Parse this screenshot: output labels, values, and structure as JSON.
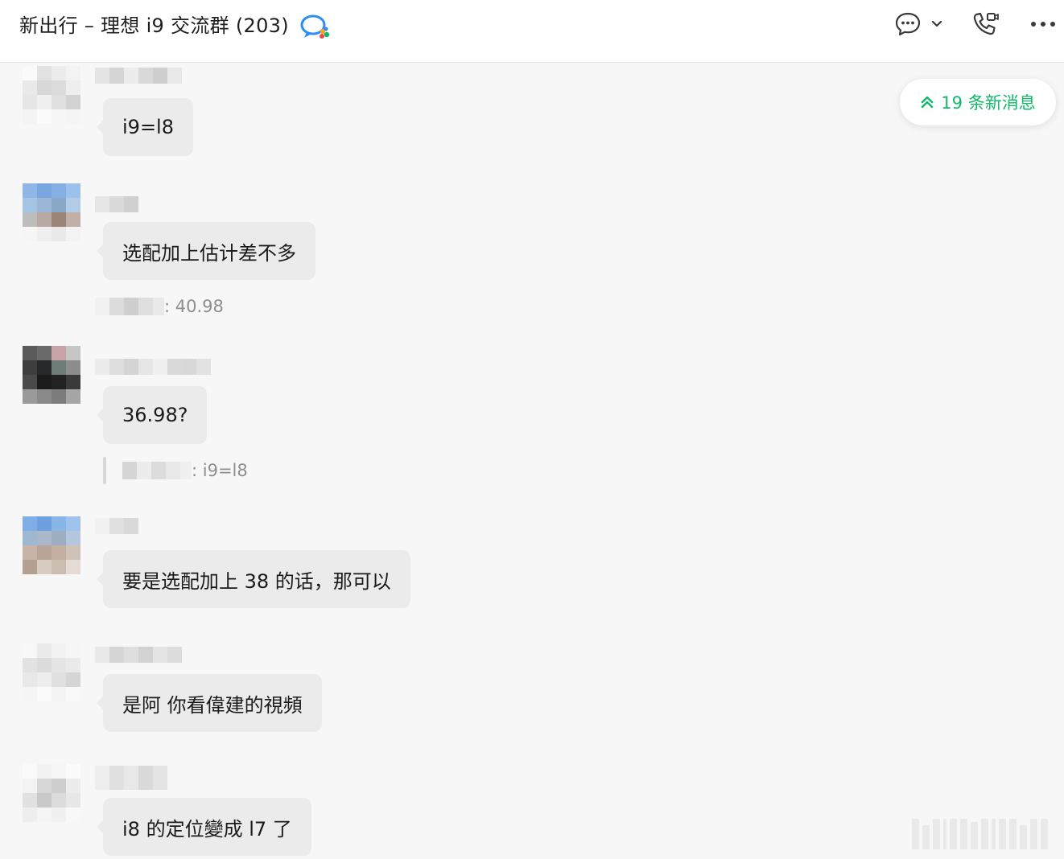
{
  "header": {
    "title": "新出行 – 理想 i9 交流群 (203)",
    "icons": [
      "chat-bubble-icon",
      "chevron-down-icon",
      "phone-video-icon",
      "more-icon"
    ]
  },
  "new_messages": {
    "label": "19 条新消息",
    "icon": "double-chevron-up-icon",
    "color": "#11b86a"
  },
  "messages": [
    {
      "text": "i9=l8"
    },
    {
      "text": "选配加上估计差不多",
      "quote": ": 40.98"
    },
    {
      "text": "36.98?",
      "quote": ": i9=l8"
    },
    {
      "text": "要是选配加上 38 的话，那可以"
    },
    {
      "text": "是阿 你看偉建的視頻"
    },
    {
      "text": "i8 的定位變成 l7 了"
    }
  ],
  "colors": {
    "bubble": "#ebebeb",
    "background": "#f7f7f7",
    "accent": "#11b86a"
  }
}
